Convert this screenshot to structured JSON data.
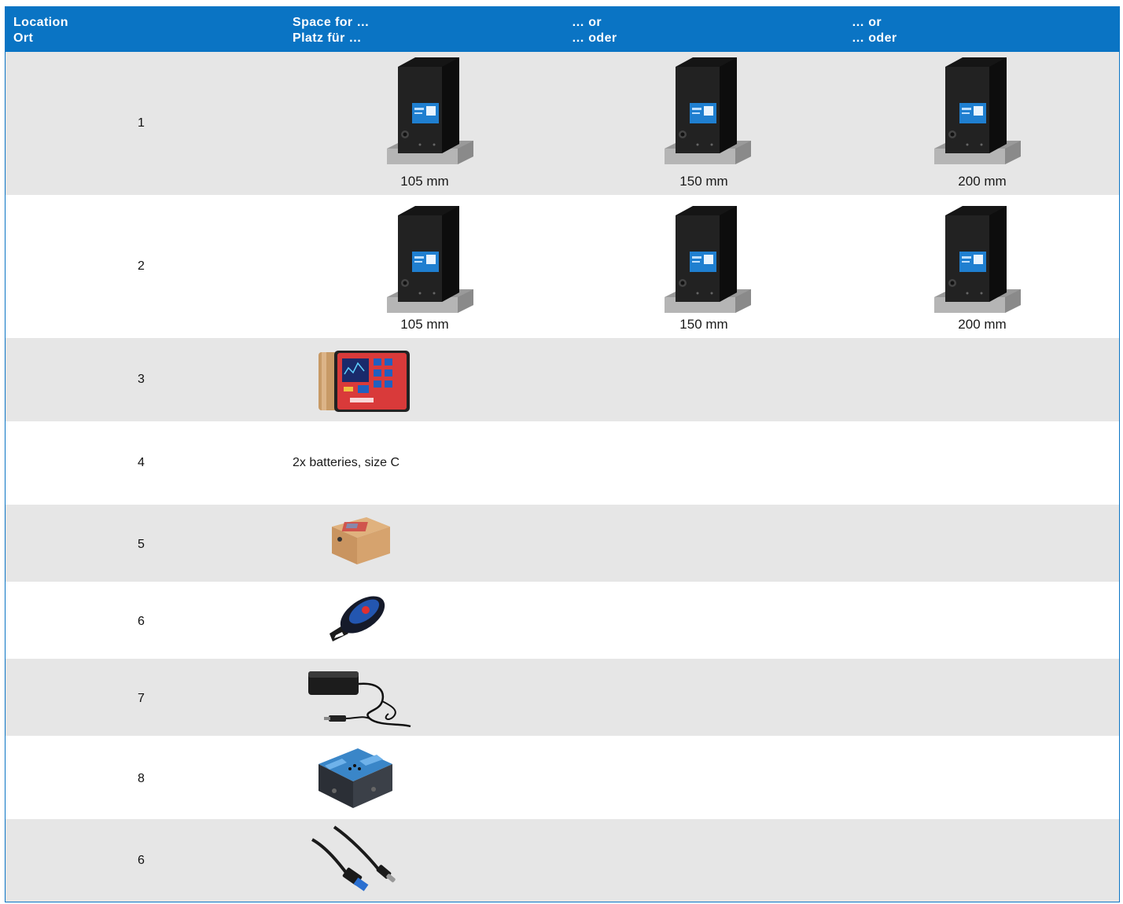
{
  "header": {
    "col1": {
      "line1": "Location",
      "line2": "Ort"
    },
    "col2": {
      "line1": "Space for …",
      "line2": "Platz für …"
    },
    "col3": {
      "line1": "… or",
      "line2": "… oder"
    },
    "col4": {
      "line1": "… or",
      "line2": "… oder"
    }
  },
  "rows": [
    {
      "location": "1",
      "items": [
        {
          "icon": "flow-meter-icon",
          "caption": "105 mm"
        },
        {
          "icon": "flow-meter-icon",
          "caption": "150 mm"
        },
        {
          "icon": "flow-meter-icon",
          "caption": "200 mm"
        }
      ]
    },
    {
      "location": "2",
      "items": [
        {
          "icon": "flow-meter-icon",
          "caption": "105 mm"
        },
        {
          "icon": "flow-meter-icon",
          "caption": "150 mm"
        },
        {
          "icon": "flow-meter-icon",
          "caption": "200 mm"
        }
      ]
    },
    {
      "location": "3",
      "items": [
        {
          "icon": "display-unit-icon"
        }
      ]
    },
    {
      "location": "4",
      "items": [
        {
          "text": "2x batteries, size C"
        }
      ]
    },
    {
      "location": "5",
      "items": [
        {
          "icon": "battery-box-icon"
        }
      ]
    },
    {
      "location": "6",
      "items": [
        {
          "icon": "remote-control-icon"
        }
      ]
    },
    {
      "location": "7",
      "items": [
        {
          "icon": "power-adapter-icon"
        }
      ]
    },
    {
      "location": "8",
      "items": [
        {
          "icon": "interface-module-icon"
        }
      ]
    },
    {
      "location": "6",
      "items": [
        {
          "icon": "usb-cable-icon"
        }
      ]
    }
  ],
  "colors": {
    "header": "#0a74c4",
    "row_grey": "#e6e6e6",
    "row_white": "#ffffff"
  }
}
